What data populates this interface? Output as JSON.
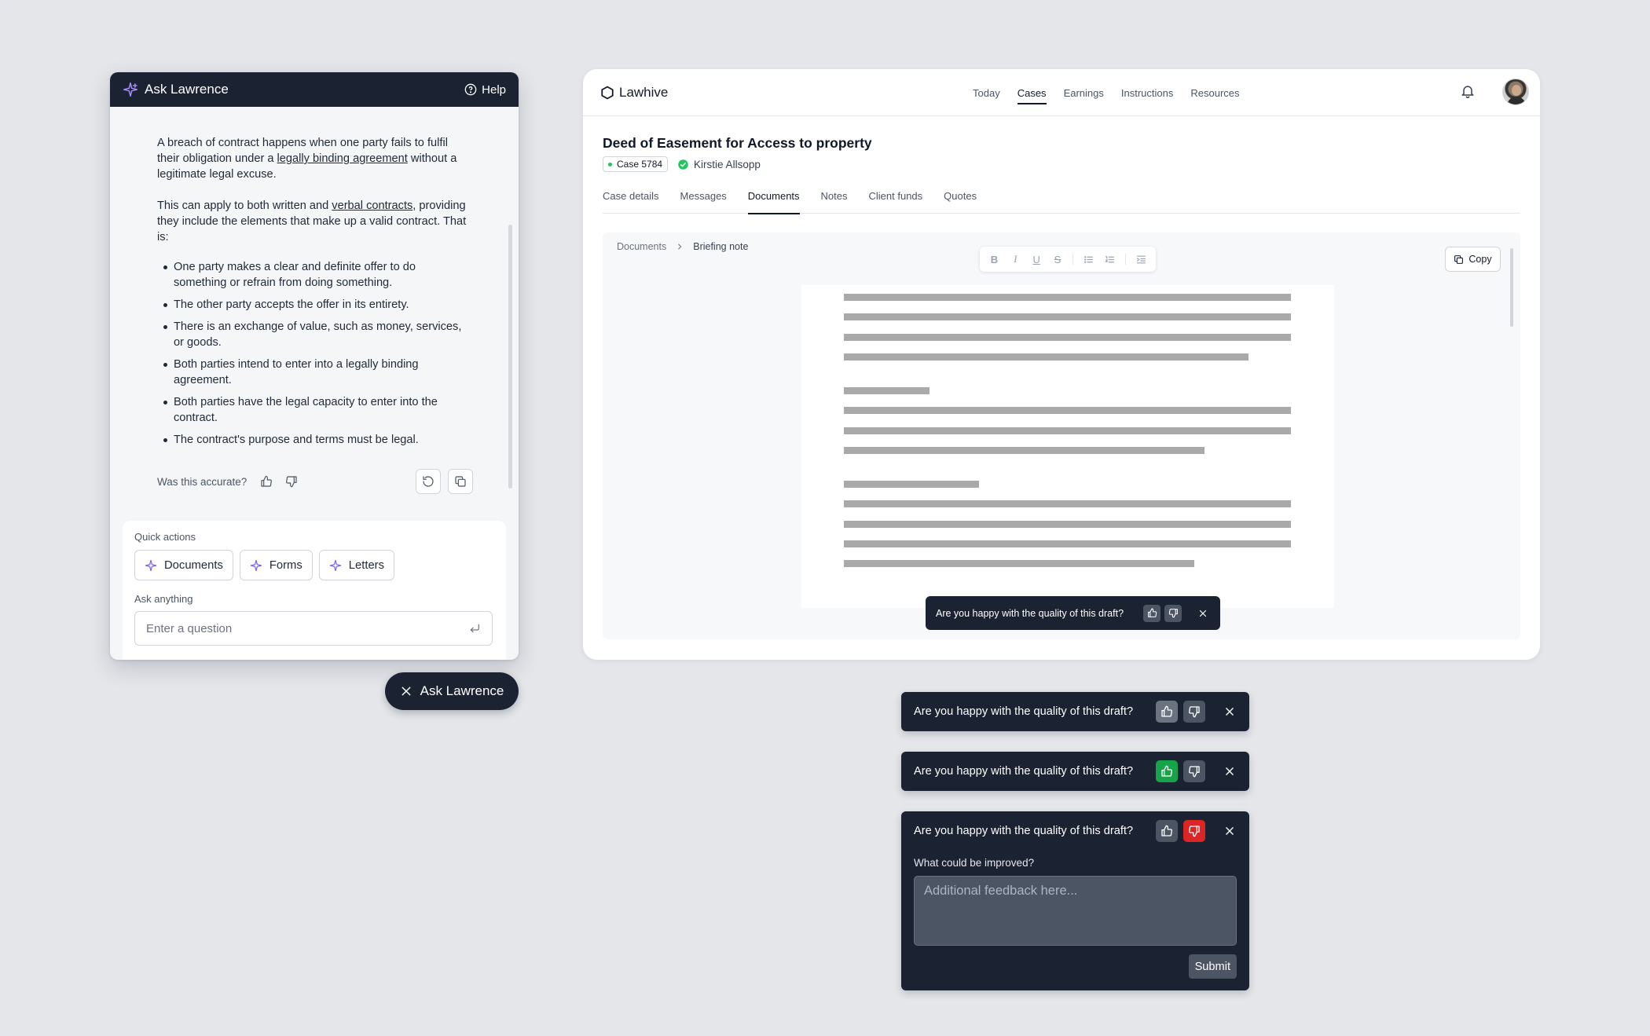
{
  "assistant": {
    "title": "Ask Lawrence",
    "help_label": "Help",
    "answer": {
      "p1_a": "A breach of contract happens when one party fails to fulfil their obligation under a ",
      "p1_link": "legally binding agreement",
      "p1_b": " without a legitimate legal excuse.",
      "p2_a": "This can apply to both written and ",
      "p2_link": "verbal contracts",
      "p2_b": ", providing they include the elements that make up a valid contract. That is:",
      "bullets": [
        "One party makes a clear and definite offer to do something or refrain from doing something.",
        "The other party accepts the offer in its entirety.",
        "There is an exchange of value, such as money, services, or goods.",
        "Both parties intend to enter into a legally binding agreement.",
        "Both parties have the legal capacity to enter into the contract.",
        "The contract's purpose and terms must be legal."
      ]
    },
    "accuracy_prompt": "Was this accurate?",
    "quick_actions_label": "Quick actions",
    "quick_actions": [
      "Documents",
      "Forms",
      "Letters"
    ],
    "ask_label": "Ask anything",
    "input_placeholder": "Enter a question",
    "pill_label": "Ask Lawrence",
    "accent_color": "#7c5cf2"
  },
  "app": {
    "brand": "Lawhive",
    "nav": [
      "Today",
      "Cases",
      "Earnings",
      "Instructions",
      "Resources"
    ],
    "active_nav": "Cases",
    "case_title": "Deed of Easement for Access to property",
    "case_badge": "Case 5784",
    "client_name": "Kirstie Allsopp",
    "tabs": [
      "Case details",
      "Messages",
      "Documents",
      "Notes",
      "Client funds",
      "Quotes"
    ],
    "active_tab": "Documents",
    "breadcrumb": [
      "Documents",
      "Briefing note"
    ],
    "format_tools": [
      "B",
      "I",
      "U",
      "S"
    ],
    "copy_label": "Copy",
    "draft_question": "Are you happy with the quality of this draft?"
  },
  "feedback": {
    "question": "Are you happy with the quality of this draft?",
    "improve_label": "What could be improved?",
    "textarea_placeholder": "Additional feedback here...",
    "submit_label": "Submit",
    "colors": {
      "positive": "#16a34a",
      "negative": "#dc2626",
      "toast_bg": "#1b2333"
    }
  }
}
